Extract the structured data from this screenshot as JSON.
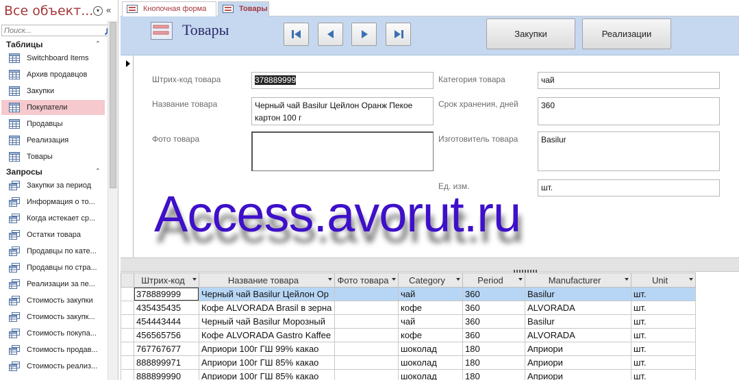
{
  "nav": {
    "title": "Все объект...",
    "search_placeholder": "Поиск...",
    "groups": [
      {
        "label": "Таблицы",
        "items": [
          {
            "label": "Switchboard Items",
            "type": "table"
          },
          {
            "label": "Архив продавцов",
            "type": "table"
          },
          {
            "label": "Закупки",
            "type": "table"
          },
          {
            "label": "Покупатели",
            "type": "table",
            "selected": true
          },
          {
            "label": "Продавцы",
            "type": "table"
          },
          {
            "label": "Реализация",
            "type": "table"
          },
          {
            "label": "Товары",
            "type": "table"
          }
        ]
      },
      {
        "label": "Запросы",
        "items": [
          {
            "label": "Закупки за период",
            "type": "query"
          },
          {
            "label": "Информация о то...",
            "type": "query"
          },
          {
            "label": "Когда истекает ср...",
            "type": "query"
          },
          {
            "label": "Остатки товара",
            "type": "query"
          },
          {
            "label": "Продавцы по кате...",
            "type": "query"
          },
          {
            "label": "Продавцы по стра...",
            "type": "query"
          },
          {
            "label": "Реализации за пе...",
            "type": "query"
          },
          {
            "label": "Стоимость закупки",
            "type": "query"
          },
          {
            "label": "Стоимость закупк...",
            "type": "query"
          },
          {
            "label": "Стоимость покупа...",
            "type": "query"
          },
          {
            "label": "Стоимость продав...",
            "type": "query"
          },
          {
            "label": "Стоимость реализ...",
            "type": "query"
          }
        ]
      }
    ]
  },
  "tabs": [
    {
      "label": "Кнопочная форма",
      "active": false
    },
    {
      "label": "Товары",
      "active": true
    }
  ],
  "form": {
    "title": "Товары",
    "buttons": {
      "purchases": "Закупки",
      "sales": "Реализации"
    },
    "fields": {
      "barcode": {
        "label": "Штрих-код товара",
        "value": "378889999"
      },
      "name": {
        "label": "Название товара",
        "value": "Черный чай Basilur Цейлон Оранж Пекое картон 100 г"
      },
      "photo": {
        "label": "Фото товара",
        "value": ""
      },
      "category": {
        "label": "Категория товара",
        "value": "чай"
      },
      "shelf_life": {
        "label": "Срок хранения, дней",
        "value": "360"
      },
      "manufacturer": {
        "label": "Изготовитель товара",
        "value": "Basilur"
      },
      "unit": {
        "label": "Ед. изм.",
        "value": "шт."
      }
    }
  },
  "watermark": "Access.avorut.ru",
  "sheet": {
    "columns": [
      "Штрих-код",
      "Название товара",
      "Фото товара",
      "Category",
      "Period",
      "Manufacturer",
      "Unit"
    ],
    "rows": [
      [
        "378889999",
        "Черный чай Basilur Цейлон Ор",
        "",
        "чай",
        "360",
        "Basilur",
        "шт."
      ],
      [
        "435435435",
        "Кофе ALVORADA Brasil в зерна",
        "",
        "кофе",
        "360",
        "ALVORADA",
        "шт."
      ],
      [
        "454443444",
        "Черный чай Basilur Морозный",
        "",
        "чай",
        "360",
        " Basilur",
        "шт."
      ],
      [
        "456565756",
        "Кофе ALVORADA Gastro Kaffee",
        "",
        "кофе",
        "360",
        "ALVORADA",
        "шт."
      ],
      [
        "767767677",
        "Априори 100г ГШ 99% какао",
        "",
        "шоколад",
        "180",
        "Априори",
        "шт."
      ],
      [
        "888899971",
        "Априори 100г ГШ 85% какао",
        "",
        "шоколад",
        "180",
        "Априори",
        "шт."
      ],
      [
        "888899990",
        "Априори 100г ГШ 85% какао",
        "",
        "шоколад",
        "180",
        "Априори",
        "шт."
      ]
    ]
  },
  "colors": {
    "accent": "#a4373a",
    "header_bg": "#c6d8f0",
    "selection": "#f5c9cd",
    "row_highlight": "#b7d6f5",
    "watermark": "#3e10c9"
  }
}
